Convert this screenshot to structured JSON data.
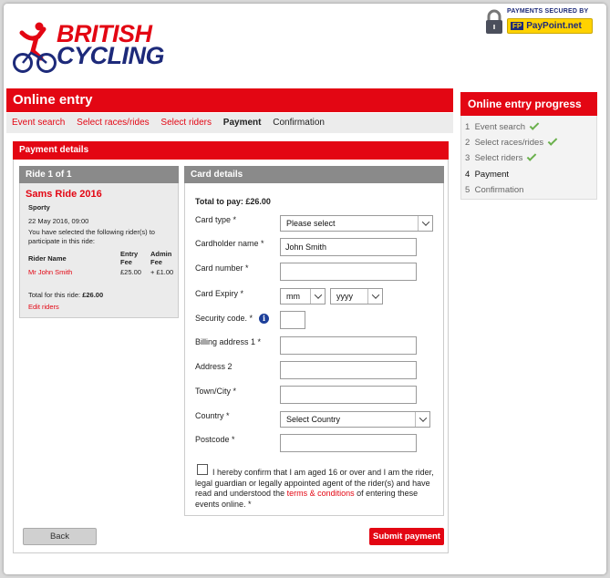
{
  "brand": {
    "line1": "BRITISH",
    "line2": "CYCLING"
  },
  "payments_badge": {
    "label": "PAYMENTS SECURED BY",
    "logo_text": "PayPoint.net",
    "logo_mark": "FP"
  },
  "header": {
    "title": "Online entry"
  },
  "breadcrumb": [
    "Event search",
    "Select races/rides",
    "Select riders",
    "Payment",
    "Confirmation"
  ],
  "payment": {
    "title": "Payment details",
    "ride": {
      "header": "Ride 1 of 1",
      "name": "Sams Ride 2016",
      "category": "Sporty",
      "date": "22 May 2016, 09:00",
      "intro": "You have selected the following rider(s) to participate in this ride:",
      "col_rider": "Rider Name",
      "col_entry_1": "Entry",
      "col_entry_2": "Fee",
      "col_admin_1": "Admin",
      "col_admin_2": "Fee",
      "rider_name": "Mr John Smith",
      "entry_fee": "£25.00",
      "admin_fee": "+ £1.00",
      "total_label": "Total for this ride:",
      "total_value": "£26.00",
      "edit_link": "Edit riders"
    },
    "card": {
      "header": "Card details",
      "total_label": "Total to pay:",
      "total_value": "£26.00",
      "card_type_label": "Card type *",
      "card_type_value": "Please select",
      "holder_label": "Cardholder name *",
      "holder_value": "John Smith",
      "number_label": "Card number *",
      "number_value": "",
      "expiry_label": "Card Expiry *",
      "expiry_month": "mm",
      "expiry_year": "yyyy",
      "security_label": "Security code. *",
      "security_value": "",
      "billing1_label": "Billing address 1 *",
      "address2_label": "Address 2",
      "town_label": "Town/City *",
      "country_label": "Country *",
      "country_value": "Select Country",
      "postcode_label": "Postcode *",
      "confirm_pre": "I hereby confirm that I am aged 16 or over and I am the rider, legal guardian or legally appointed agent of the rider(s) and have read and understood the",
      "confirm_link": "terms & conditions",
      "confirm_post": "of entering these events online. *"
    },
    "back_label": "Back",
    "submit_label": "Submit payment"
  },
  "progress": {
    "title": "Online entry progress",
    "items": [
      {
        "num": "1",
        "label": "Event search"
      },
      {
        "num": "2",
        "label": "Select races/rides"
      },
      {
        "num": "3",
        "label": "Select riders"
      },
      {
        "num": "4",
        "label": "Payment"
      },
      {
        "num": "5",
        "label": "Confirmation"
      }
    ]
  },
  "colors": {
    "brand_red": "#e30613",
    "brand_blue": "#1d2a7a",
    "check_green": "#6ab04c"
  }
}
